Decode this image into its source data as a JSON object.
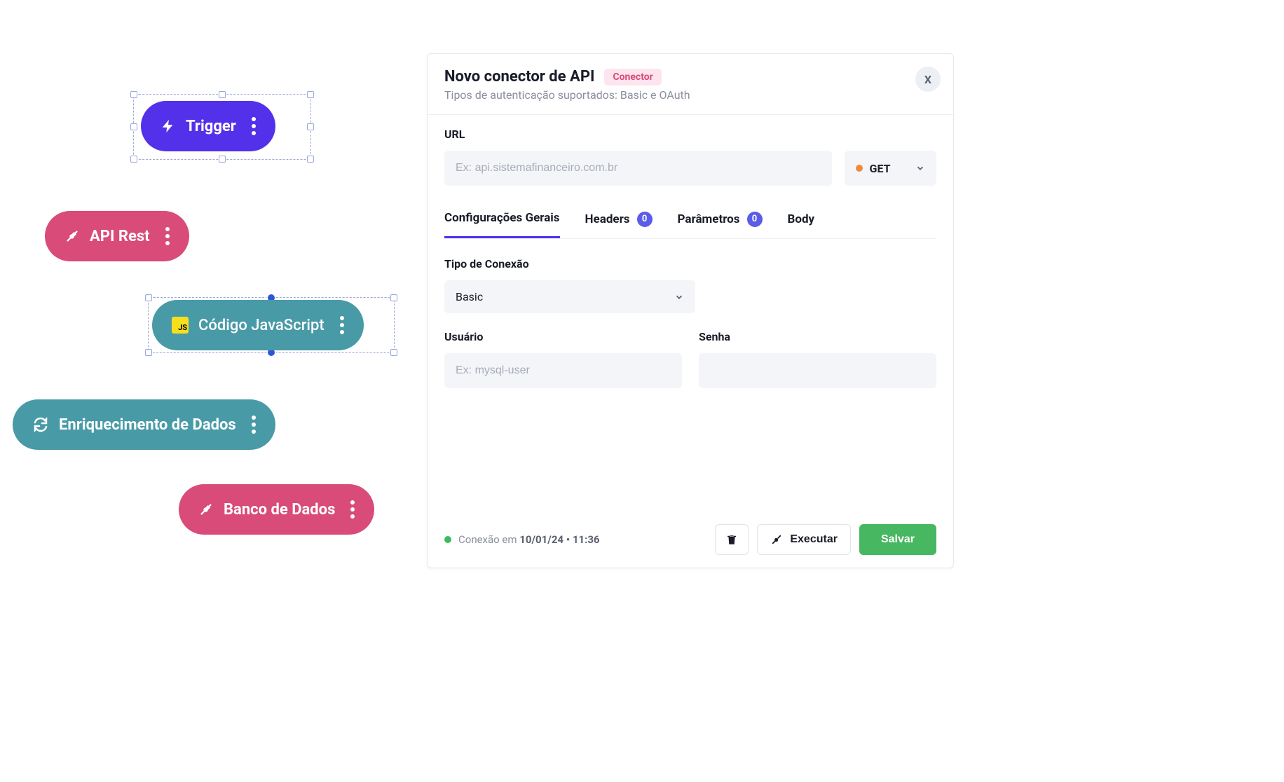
{
  "nodes": {
    "trigger": {
      "label": "Trigger"
    },
    "apirest": {
      "label": "API Rest"
    },
    "js": {
      "label": "Código JavaScript"
    },
    "enrich": {
      "label": "Enriquecimento de Dados"
    },
    "db": {
      "label": "Banco de Dados"
    }
  },
  "panel": {
    "title": "Novo conector de API",
    "badge": "Conector",
    "subtitle": "Tipos de autenticação suportados: Basic e OAuth",
    "close": "X",
    "url_label": "URL",
    "url_placeholder": "Ex: api.sistemafinanceiro.com.br",
    "method": "GET",
    "tabs": {
      "general": "Configurações Gerais",
      "headers": "Headers",
      "headers_count": "0",
      "params": "Parâmetros",
      "params_count": "0",
      "body": "Body"
    },
    "conn_type_label": "Tipo de Conexão",
    "conn_type_value": "Basic",
    "user_label": "Usuário",
    "user_placeholder": "Ex: mysql-user",
    "pass_label": "Senha",
    "status_prefix": "Conexão em ",
    "status_bold": "10/01/24 • 11:36",
    "execute": "Executar",
    "save": "Salvar"
  }
}
